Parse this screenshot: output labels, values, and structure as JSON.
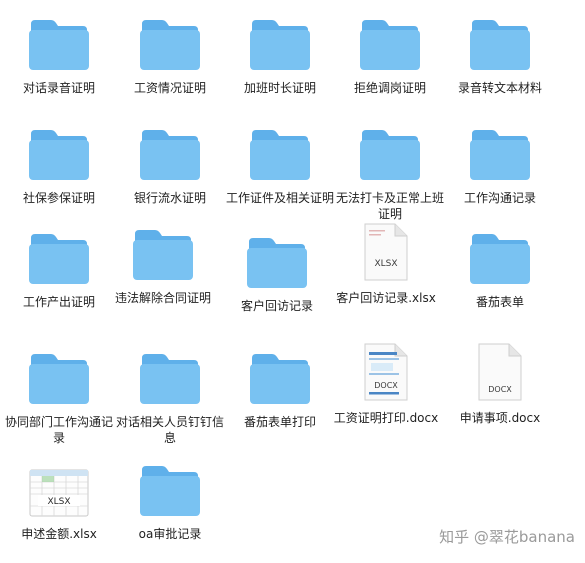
{
  "items": [
    {
      "label": "对话录音证明",
      "kind": "folder"
    },
    {
      "label": "工资情况证明",
      "kind": "folder"
    },
    {
      "label": "加班时长证明",
      "kind": "folder"
    },
    {
      "label": "拒绝调岗证明",
      "kind": "folder"
    },
    {
      "label": "录音转文本材料",
      "kind": "folder"
    },
    {
      "label": "社保参保证明",
      "kind": "folder"
    },
    {
      "label": "银行流水证明",
      "kind": "folder"
    },
    {
      "label": "工作证件及相关证明",
      "kind": "folder"
    },
    {
      "label": "无法打卡及正常上班证明",
      "kind": "folder"
    },
    {
      "label": "工作沟通记录",
      "kind": "folder"
    },
    {
      "label": "工作产出证明",
      "kind": "folder"
    },
    {
      "label": "违法解除合同证明",
      "kind": "folder"
    },
    {
      "label": "客户回访记录",
      "kind": "folder"
    },
    {
      "label": "客户回访记录.xlsx",
      "kind": "xlsx-doc",
      "badge": "XLSX"
    },
    {
      "label": "番茄表单",
      "kind": "folder"
    },
    {
      "label": "协同部门工作沟通记录",
      "kind": "folder"
    },
    {
      "label": "对话相关人员钉钉信息",
      "kind": "folder"
    },
    {
      "label": "番茄表单打印",
      "kind": "folder"
    },
    {
      "label": "工资证明打印.docx",
      "kind": "docx-preview",
      "badge": "DOCX"
    },
    {
      "label": "申请事项.docx",
      "kind": "docx-plain",
      "badge": "DOCX"
    },
    {
      "label": "申述金额.xlsx",
      "kind": "xlsx-sheet",
      "badge": "XLSX"
    },
    {
      "label": "oa审批记录",
      "kind": "folder"
    }
  ],
  "watermark": {
    "text": "知乎 @翠花banana"
  },
  "colors": {
    "folder_front": "#79c2f2",
    "folder_back": "#5fb0ea",
    "label": "#1f1f1f",
    "watermark": "#9a9a9a"
  }
}
